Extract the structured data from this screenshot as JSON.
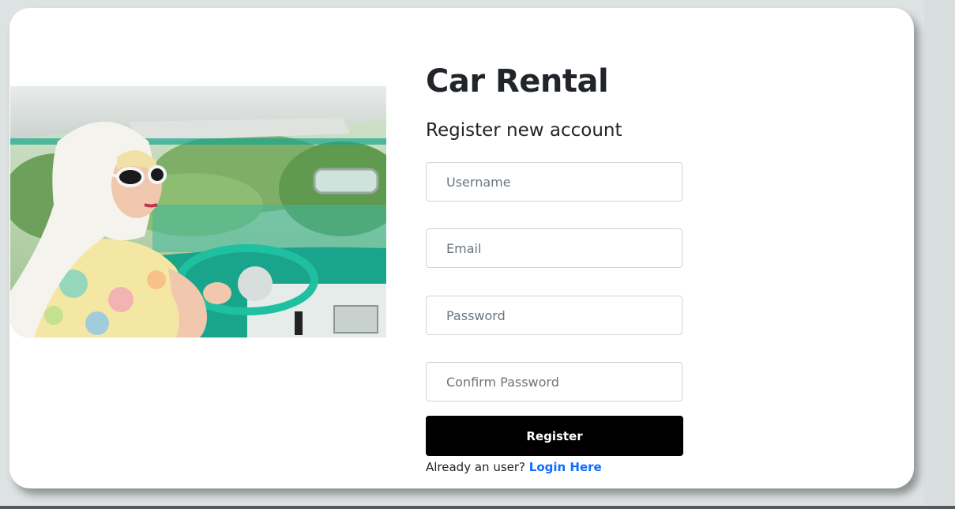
{
  "app": {
    "title": "Car Rental",
    "subtitle": "Register new account"
  },
  "form": {
    "username_placeholder": "Username",
    "email_placeholder": "Email",
    "password_placeholder": "Password",
    "confirm_placeholder": "Confirm Password",
    "register_label": "Register"
  },
  "footer": {
    "prompt": "Already an user?",
    "login_label": "Login Here"
  },
  "colors": {
    "background": "#dde2e2",
    "button": "#000000",
    "link": "#0d6efd",
    "car_interior": "#1fb39b"
  }
}
